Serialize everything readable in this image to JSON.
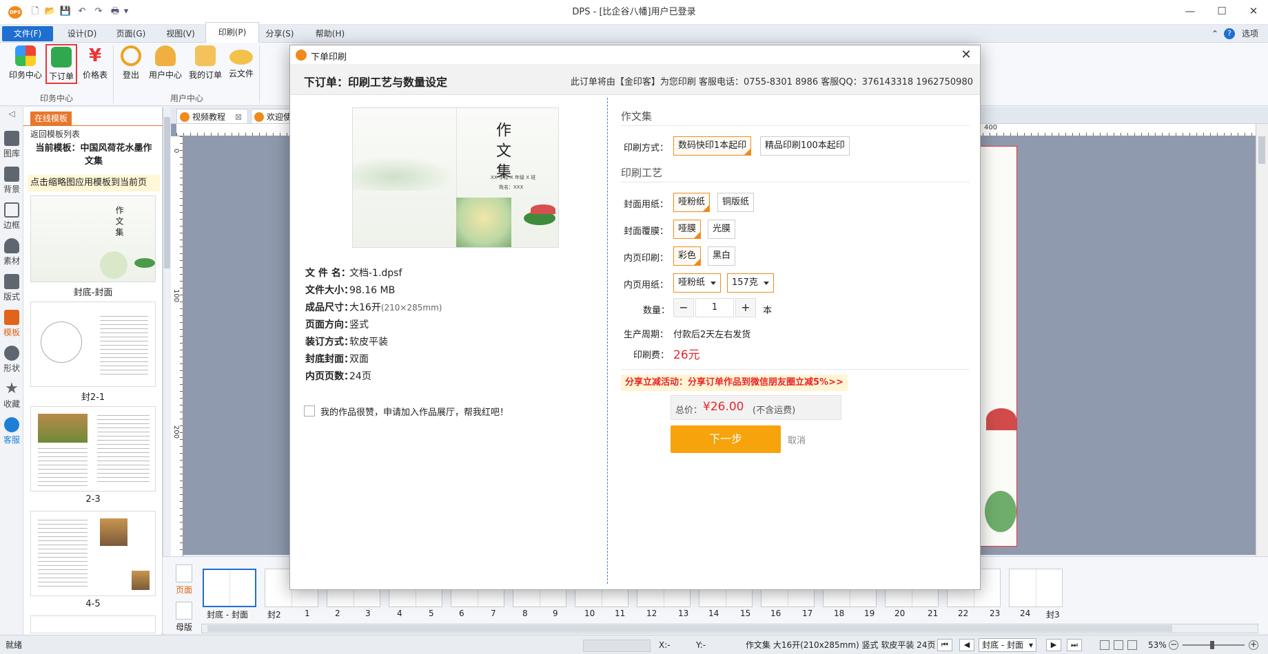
{
  "window": {
    "title": "DPS - [比企谷八幡]用户已登录",
    "logo": "DPS",
    "controls": {
      "minimize": "—",
      "maximize": "☐",
      "close": "✕"
    }
  },
  "quick_access": {
    "new": "🗋",
    "open": "📂",
    "save": "💾",
    "undo": "↶",
    "redo": "↷",
    "print": "🖶",
    "more": "▾"
  },
  "menu": {
    "items": [
      "文件(F)",
      "设计(D)",
      "页面(G)",
      "视图(V)",
      "印刷(P)",
      "分享(S)",
      "帮助(H)"
    ],
    "right_options": "选项",
    "help_icon": "?",
    "collapse_icon": "⌃"
  },
  "ribbon": {
    "group1": {
      "label": "印务中心",
      "buttons": [
        "印务中心",
        "下订单",
        "价格表"
      ]
    },
    "group2": {
      "label": "用户中心",
      "buttons": [
        "登出",
        "用户中心",
        "我的订单",
        "云文件"
      ]
    }
  },
  "left_sidebar": {
    "collapse": "◁",
    "items": [
      "图库",
      "背景",
      "边框",
      "素材",
      "版式",
      "模板",
      "形状",
      "收藏",
      "客服"
    ]
  },
  "template_panel": {
    "tab": "在线模板",
    "back_link": "返回模板列表",
    "current_template": "当前模板：中国风荷花水墨作文集",
    "hint": "点击缩略图应用模板到当前页",
    "thumbs": [
      "封底-封面",
      "封2-1",
      "2-3",
      "4-5"
    ]
  },
  "doc_tabs": [
    "视频教程",
    "欢迎使用"
  ],
  "ruler": {
    "h_marks": [
      "400"
    ],
    "v_marks": [
      "0",
      "100",
      "200"
    ]
  },
  "bottom_strip": {
    "side_buttons": [
      "页面",
      "母版"
    ],
    "page_labels": [
      "封底 - 封面",
      "封2",
      "1",
      "2",
      "3",
      "4",
      "5",
      "6",
      "7",
      "8",
      "9",
      "10",
      "11",
      "12",
      "13",
      "14",
      "15",
      "16",
      "17",
      "18",
      "19",
      "20",
      "21",
      "22",
      "23",
      "24",
      "封3"
    ]
  },
  "statusbar": {
    "left": "就绪",
    "x_label": "X:-",
    "y_label": "Y:-",
    "doc_info": "作文集 大16开(210x285mm) 竖式 软皮平装 24页",
    "page_select": "封底 - 封面",
    "zoom": "53%"
  },
  "dialog": {
    "title": "下单印刷",
    "header": "下订单：印刷工艺与数量设定",
    "contact": "此订单将由【金印客】为您印刷 客服电话：0755-8301 8986 客服QQ：376143318 1962750980",
    "cover_title": "作文集",
    "cover_subtitle": "XX 学校 X 年级 X 班",
    "cover_name": "姓名：XXX",
    "info": [
      {
        "label": "文 件 名：",
        "value": "文档-1.dpsf"
      },
      {
        "label": "文件大小：",
        "value": "98.16 MB"
      },
      {
        "label": "成品尺寸：",
        "value": "大16开",
        "extra": "(210×285mm)"
      },
      {
        "label": "页面方向：",
        "value": "竖式"
      },
      {
        "label": "装订方式：",
        "value": "软皮平装"
      },
      {
        "label": "封底封面：",
        "value": "双面"
      },
      {
        "label": "内页页数：",
        "value": "24页"
      }
    ],
    "exhibit_checkbox": "我的作品很赞，申请加入作品展厅，帮我红吧！",
    "section_product": "作文集",
    "print_method_label": "印刷方式：",
    "print_methods": [
      "数码快印1本起印",
      "精品印刷100本起印"
    ],
    "section_craft": "印刷工艺",
    "cover_paper_label": "封面用纸：",
    "cover_papers": [
      "哑粉纸",
      "铜版纸"
    ],
    "cover_film_label": "封面覆膜：",
    "cover_films": [
      "哑膜",
      "光膜"
    ],
    "inner_print_label": "内页印刷：",
    "inner_prints": [
      "彩色",
      "黑白"
    ],
    "inner_paper_label": "内页用纸：",
    "inner_paper": "哑粉纸",
    "inner_weight": "157克",
    "qty_label": "数量：",
    "qty_minus": "−",
    "qty": "1",
    "qty_plus": "+",
    "qty_unit": "本",
    "cycle_label": "生产周期：",
    "cycle": "付款后2天左右发货",
    "fee_label": "印刷费：",
    "fee": "26元",
    "promo": "分享立减活动：分享订单作品到微信朋友圈立减5%>>",
    "total_label": "总价：",
    "total": "¥26.00",
    "total_note": "(不含运费)",
    "next": "下一步",
    "cancel": "取消",
    "close": "✕"
  },
  "colors": {
    "accent": "#f08a1c",
    "primary": "#1e6fd0",
    "next_btn": "#f7a30c",
    "price": "#e8262b",
    "highlight": "#e8373a"
  }
}
